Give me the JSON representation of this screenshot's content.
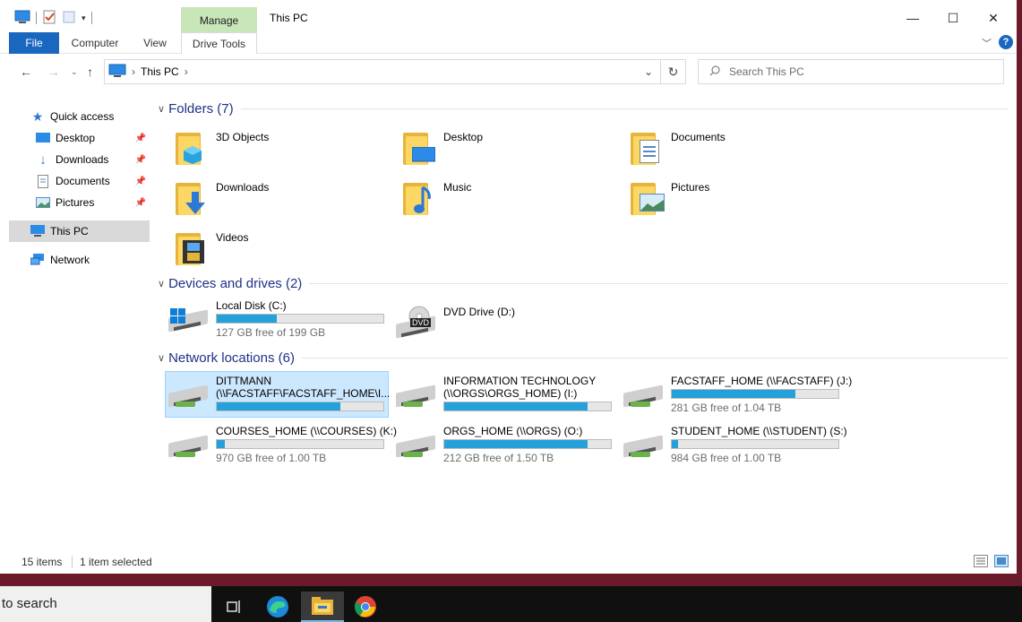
{
  "window": {
    "title": "This PC",
    "manage_label": "Manage",
    "controls": {
      "minimize": "—",
      "maximize": "☐",
      "close": "✕"
    }
  },
  "ribbon": {
    "tabs": [
      {
        "label": "File"
      },
      {
        "label": "Computer"
      },
      {
        "label": "View"
      },
      {
        "label": "Drive Tools"
      }
    ],
    "help": "?"
  },
  "address": {
    "crumb": "This PC",
    "search_placeholder": "Search This PC"
  },
  "nav_pane": {
    "quick_access": "Quick access",
    "quick_items": [
      {
        "label": "Desktop"
      },
      {
        "label": "Downloads"
      },
      {
        "label": "Documents"
      },
      {
        "label": "Pictures"
      }
    ],
    "this_pc": "This PC",
    "network": "Network"
  },
  "sections": {
    "folders": "Folders (7)",
    "devices": "Devices and drives (2)",
    "network": "Network locations (6)"
  },
  "folders": [
    {
      "label": "3D Objects"
    },
    {
      "label": "Desktop"
    },
    {
      "label": "Documents"
    },
    {
      "label": "Downloads"
    },
    {
      "label": "Music"
    },
    {
      "label": "Pictures"
    },
    {
      "label": "Videos"
    }
  ],
  "drives": [
    {
      "label": "Local Disk (C:)",
      "free": "127 GB free of 199 GB",
      "used_fraction": 0.36
    },
    {
      "label": "DVD Drive (D:)",
      "badge": "DVD"
    }
  ],
  "network_locations": [
    {
      "label1": "DITTMANN",
      "label2": "(\\\\FACSTAFF\\FACSTAFF_HOME\\I...",
      "free": "",
      "used_fraction": 0.74
    },
    {
      "label1": "INFORMATION TECHNOLOGY",
      "label2": "(\\\\ORGS\\ORGS_HOME) (I:)",
      "free": "",
      "used_fraction": 0.86
    },
    {
      "label1": "FACSTAFF_HOME (\\\\FACSTAFF) (J:)",
      "label2": "",
      "free": "281 GB free of 1.04 TB",
      "used_fraction": 0.74
    },
    {
      "label1": "COURSES_HOME (\\\\COURSES) (K:)",
      "label2": "",
      "free": "970 GB free of 1.00 TB",
      "used_fraction": 0.05
    },
    {
      "label1": "ORGS_HOME (\\\\ORGS) (O:)",
      "label2": "",
      "free": "212 GB free of 1.50 TB",
      "used_fraction": 0.86
    },
    {
      "label1": "STUDENT_HOME (\\\\STUDENT) (S:)",
      "label2": "",
      "free": "984 GB free of 1.00 TB",
      "used_fraction": 0.04
    }
  ],
  "status": {
    "items": "15 items",
    "selected": "1 item selected"
  },
  "taskbar": {
    "search_text": "to search"
  }
}
